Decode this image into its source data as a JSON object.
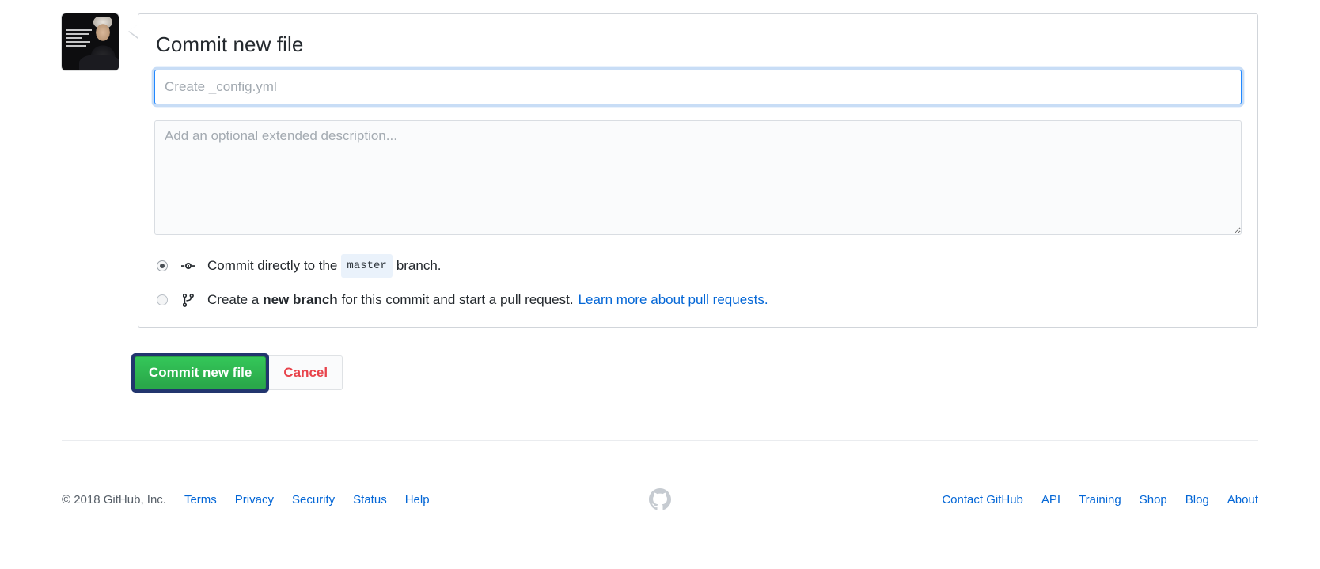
{
  "form": {
    "title": "Commit new file",
    "summary_value": "",
    "summary_placeholder": "Create _config.yml",
    "description_value": "",
    "description_placeholder": "Add an optional extended description...",
    "options": [
      {
        "icon": "git-commit-icon",
        "selected": true,
        "text_before": "Commit directly to the",
        "branch": "master",
        "text_after": "branch."
      },
      {
        "icon": "git-branch-icon",
        "selected": false,
        "text_before": "Create a",
        "emphasis": "new branch",
        "text_middle": "for this commit and start a pull request.",
        "link_label": "Learn more about pull requests."
      }
    ],
    "submit_label": "Commit new file",
    "cancel_label": "Cancel"
  },
  "avatar": {
    "name": "user-avatar"
  },
  "footer": {
    "copyright": "© 2018 GitHub, Inc.",
    "left_links": [
      "Terms",
      "Privacy",
      "Security",
      "Status",
      "Help"
    ],
    "logo": "github-mark-icon",
    "right_links": [
      "Contact GitHub",
      "API",
      "Training",
      "Shop",
      "Blog",
      "About"
    ]
  },
  "colors": {
    "accent_link": "#0366d6",
    "primary_button": "#2cbc4d",
    "focus_ring": "#22356e",
    "cancel_text": "#e8434b",
    "code_badge_bg": "#eaf2fb",
    "input_focus_border": "#2188ff"
  }
}
